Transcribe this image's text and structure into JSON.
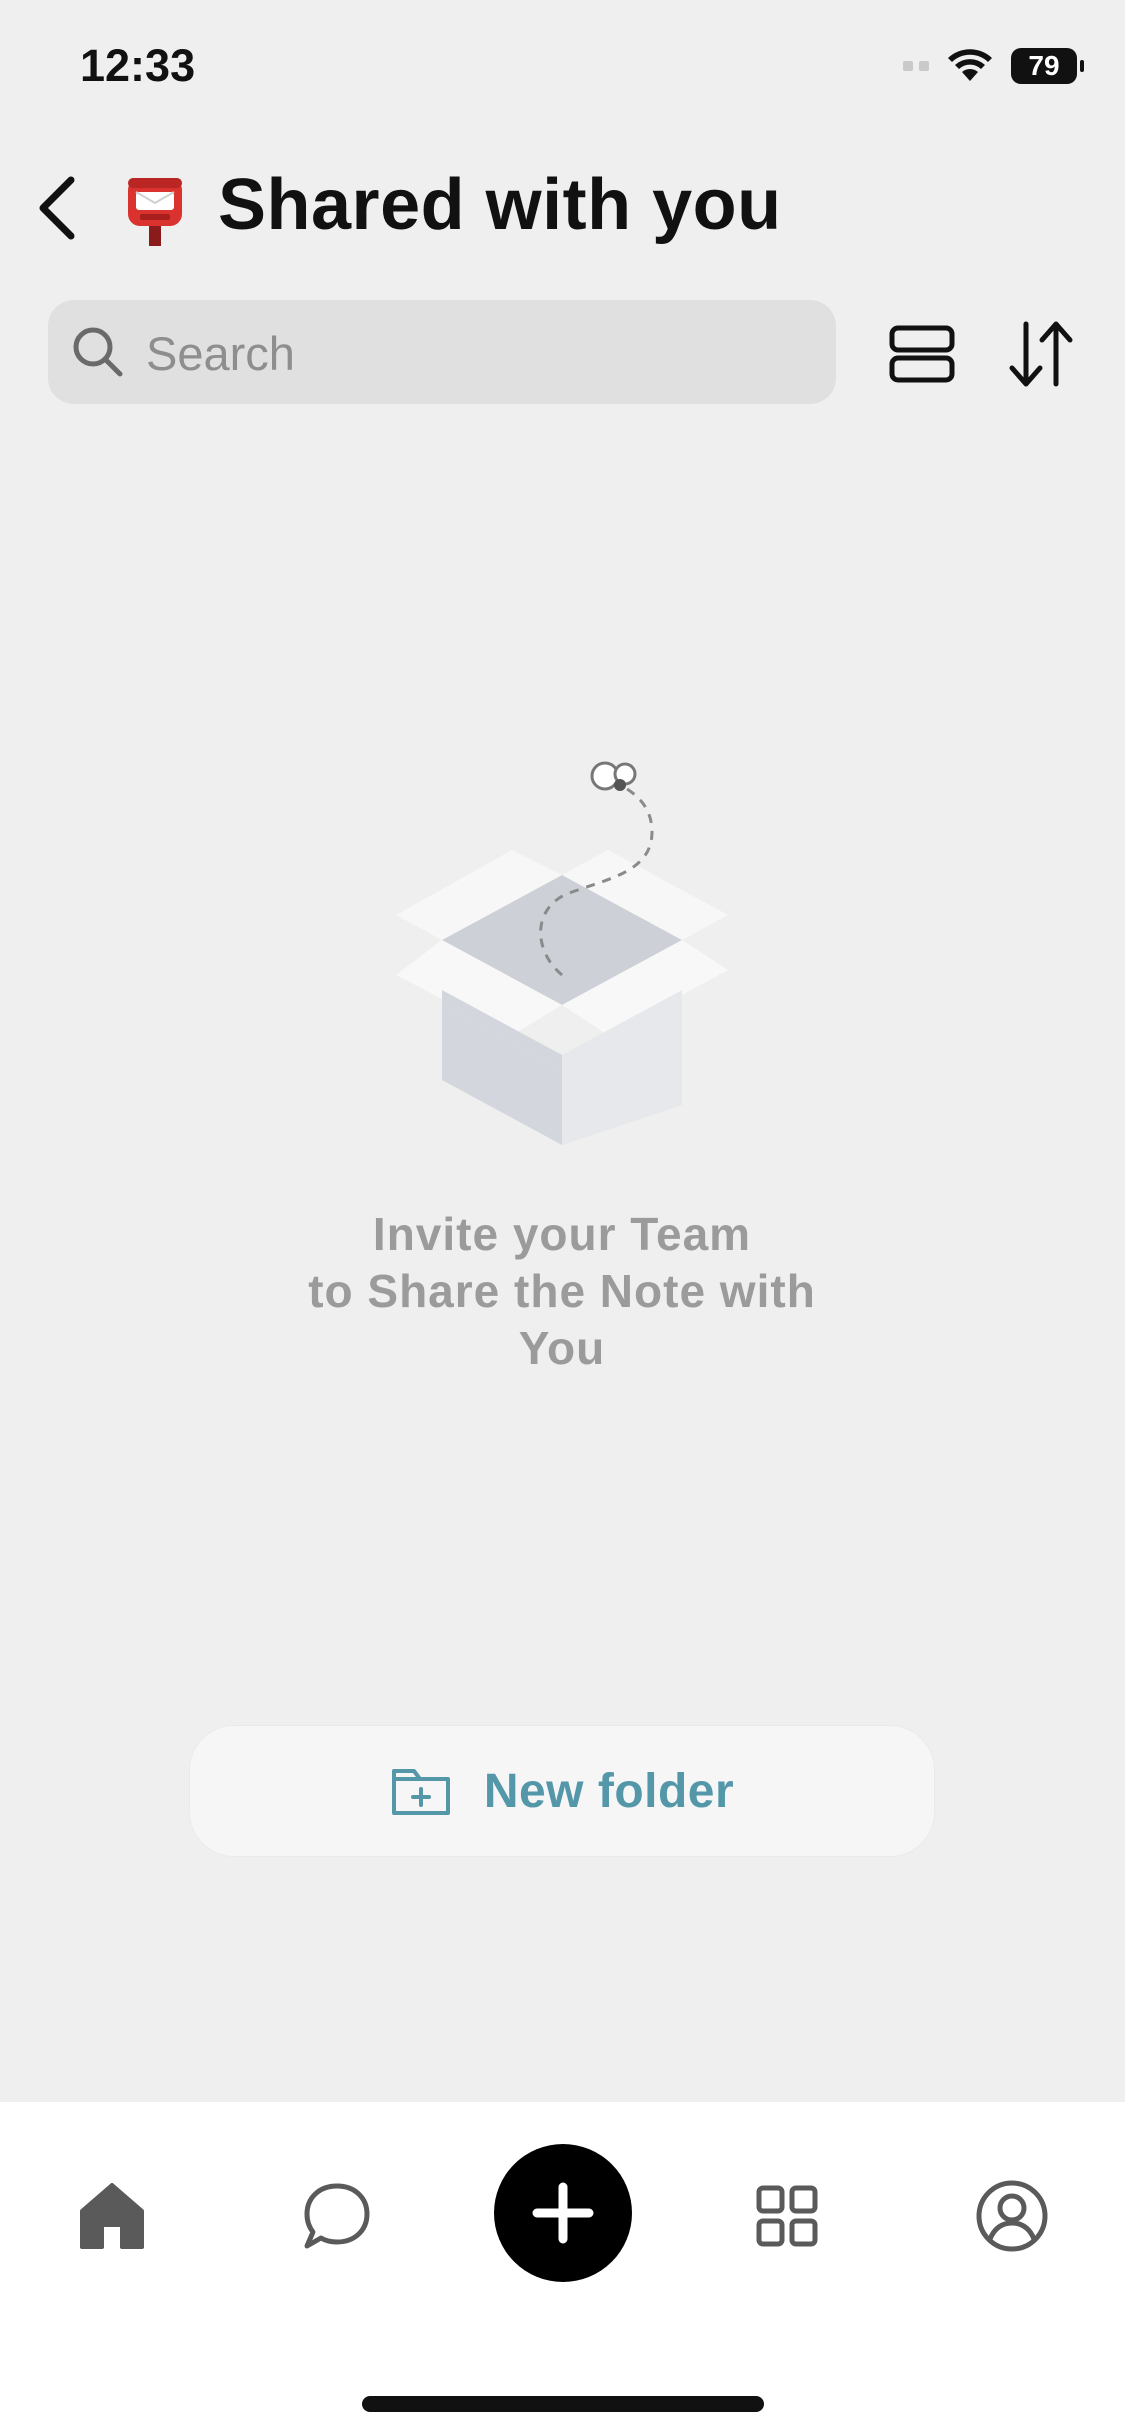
{
  "status_bar": {
    "time": "12:33",
    "battery": "79"
  },
  "header": {
    "title": "Shared with you",
    "title_emoji_icon": "postbox-icon",
    "back_icon": "chevron-left-icon"
  },
  "search": {
    "placeholder": "Search"
  },
  "toolbar": {
    "view_toggle_icon": "list-view-icon",
    "sort_icon": "sort-icon"
  },
  "empty_state": {
    "illustration_icon": "open-box-icon",
    "lines": [
      "Invite your Team",
      "to Share the Note with",
      "You"
    ]
  },
  "new_folder": {
    "label": "New folder",
    "icon": "folder-plus-icon"
  },
  "tab_bar": {
    "items": [
      {
        "icon": "home-icon"
      },
      {
        "icon": "chat-icon"
      },
      {
        "icon": "plus-icon"
      },
      {
        "icon": "apps-icon"
      },
      {
        "icon": "profile-icon"
      }
    ]
  },
  "colors": {
    "background": "#efefef",
    "accent": "#5397a8",
    "text_muted": "#9b9b9b"
  }
}
